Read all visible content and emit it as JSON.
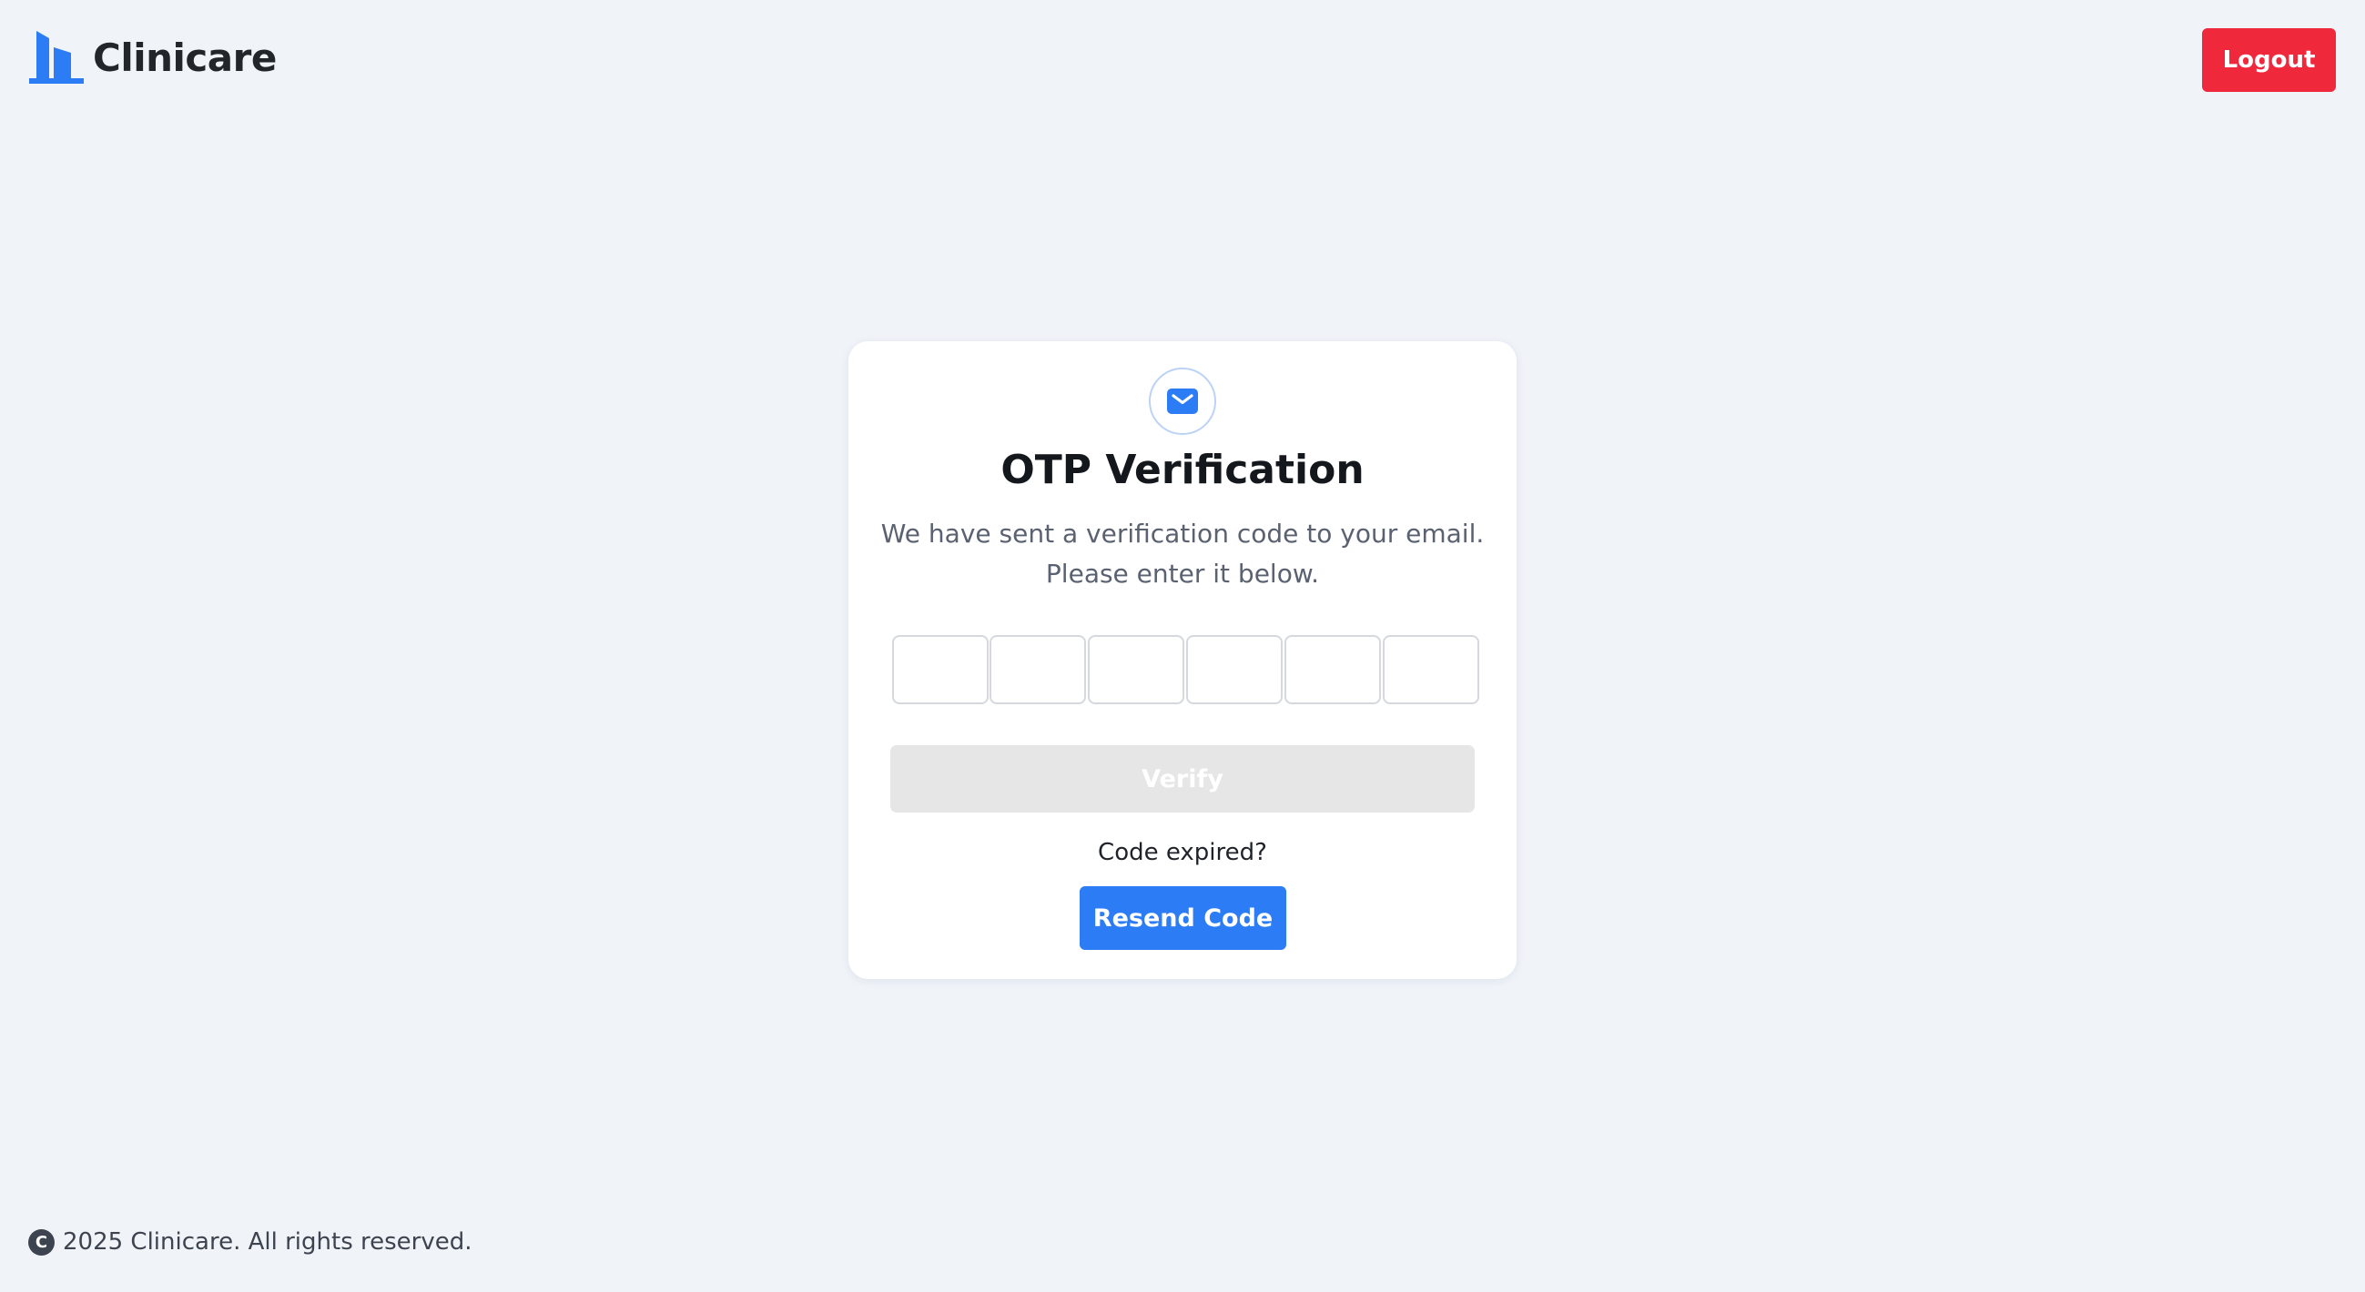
{
  "header": {
    "brand": "Clinicare",
    "logout_label": "Logout"
  },
  "otp": {
    "title": "OTP Verification",
    "description_line1": "We have sent a verification code to your email.",
    "description_line2": "Please enter it below.",
    "digit_count": 6,
    "digits": [
      "",
      "",
      "",
      "",
      "",
      ""
    ],
    "verify_label": "Verify",
    "verify_enabled": false,
    "expired_prompt": "Code expired?",
    "resend_label": "Resend Code"
  },
  "footer": {
    "copyright_symbol": "C",
    "text": "2025 Clinicare. All rights reserved."
  },
  "icons": {
    "logo": "building-logo-icon",
    "mail": "mail-icon",
    "copyright": "copyright-icon"
  },
  "colors": {
    "background": "#f0f4f9",
    "brand_blue": "#2c7cf6",
    "logout_red": "#f0283c",
    "disabled_button": "#e6e6e6"
  }
}
